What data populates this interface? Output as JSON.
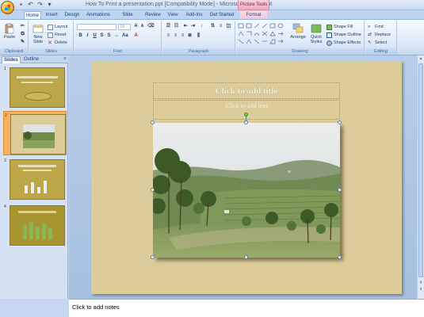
{
  "window": {
    "title": "How To Print a presentation.ppt [Compatibility Mode] - Microsoft PowerPoint",
    "context_tab_group": "Picture Tools"
  },
  "ribbon": {
    "tabs": [
      "Home",
      "Insert",
      "Design",
      "Animations",
      "Slide Show",
      "Review",
      "View",
      "Add-Ins",
      "Get Started",
      "Format"
    ],
    "active_tab": "Home",
    "clipboard": {
      "paste": "Paste",
      "label": "Clipboard"
    },
    "slides": {
      "new_slide": "New Slide",
      "layout": "Layout",
      "reset": "Reset",
      "delete": "Delete",
      "label": "Slides"
    },
    "font": {
      "size": "18",
      "label": "Font"
    },
    "paragraph": {
      "label": "Paragraph"
    },
    "drawing": {
      "arrange": "Arrange",
      "quick_styles": "Quick Styles",
      "shape_fill": "Shape Fill",
      "shape_outline": "Shape Outline",
      "shape_effects": "Shape Effects",
      "label": "Drawing"
    },
    "editing": {
      "find": "Find",
      "replace": "Replace",
      "select": "Select",
      "label": "Editing"
    }
  },
  "left_pane": {
    "tabs": [
      "Slides",
      "Outline"
    ],
    "active_tab": "Slides",
    "close_glyph": "×",
    "thumbnails": [
      "1",
      "2",
      "3",
      "4"
    ],
    "selected": "2"
  },
  "slide": {
    "title_placeholder": "Click to add title",
    "text_placeholder": "Click to add text"
  },
  "notes": {
    "placeholder": "Click to add notes"
  },
  "colors": {
    "slide_bg": "#dccc99",
    "thumb_bg": "#bda648",
    "accent_blue": "#15428b",
    "selected_thumb": "#f6b35f"
  }
}
